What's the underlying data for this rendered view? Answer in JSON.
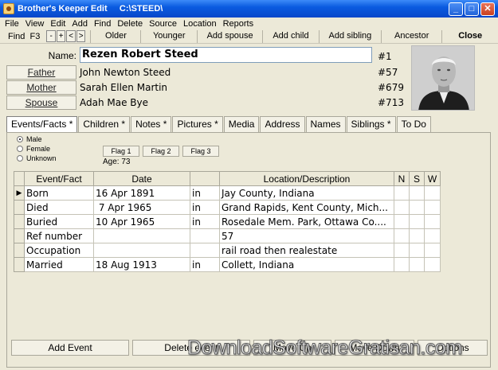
{
  "window": {
    "title": "Brother's Keeper Edit     C:\\STEED\\"
  },
  "menu": [
    "File",
    "View",
    "Edit",
    "Add",
    "Find",
    "Delete",
    "Source",
    "Location",
    "Reports"
  ],
  "toolbar": {
    "find": "Find  F3",
    "nav": [
      "-",
      "+",
      "<",
      ">"
    ],
    "buttons": [
      "Older",
      "Younger",
      "Add spouse",
      "Add child",
      "Add sibling",
      "Ancestor",
      "Close"
    ]
  },
  "person": {
    "name_label": "Name:",
    "name": "Rezen Robert Steed",
    "id": "#1",
    "father_label": "Father",
    "father": "John Newton Steed",
    "father_id": "#57",
    "mother_label": "Mother",
    "mother": "Sarah Ellen Martin",
    "mother_id": "#679",
    "spouse_label": "Spouse",
    "spouse": "Adah Mae Bye",
    "spouse_id": "#713"
  },
  "tabs": [
    "Events/Facts *",
    "Children *",
    "Notes *",
    "Pictures *",
    "Media",
    "Address",
    "Names",
    "Siblings *",
    "To Do"
  ],
  "sex_options": {
    "male": "Male",
    "female": "Female",
    "unknown": "Unknown",
    "selected": "Male"
  },
  "flags": [
    "Flag 1",
    "Flag 2",
    "Flag 3"
  ],
  "age": "Age: 73",
  "events": {
    "headers": [
      "Event/Fact",
      "Date",
      "",
      "Location/Description",
      "N",
      "S",
      "W"
    ],
    "rows": [
      {
        "event": "Born",
        "date": "16 Apr 1891",
        "prep": "in",
        "location": "Jay County, Indiana"
      },
      {
        "event": "Died",
        "date": " 7 Apr 1965",
        "prep": "in",
        "location": "Grand Rapids, Kent County, Mich..."
      },
      {
        "event": "Buried",
        "date": "10 Apr 1965",
        "prep": "in",
        "location": "Rosedale Mem. Park, Ottawa Co...."
      },
      {
        "event": "Ref number",
        "date": "",
        "prep": "",
        "location": "57"
      },
      {
        "event": "Occupation",
        "date": "",
        "prep": "",
        "location": "rail road then realestate"
      },
      {
        "event": "Married",
        "date": "18 Aug 1913",
        "prep": "in",
        "location": "Collett, Indiana"
      }
    ]
  },
  "bottom_buttons": [
    "Add Event",
    "Delete event",
    "Move Up",
    "Move Down",
    "Options"
  ],
  "watermark": "DownloadSoftwareGratisan.com",
  "colors": {
    "titlebar": "#0a5be0",
    "panel": "#ece9d8"
  }
}
